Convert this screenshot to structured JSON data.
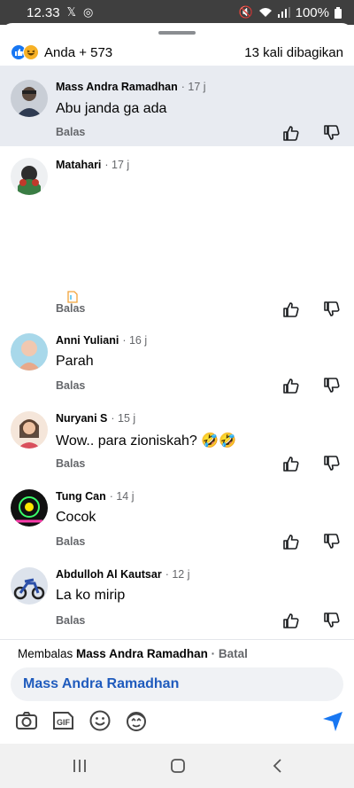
{
  "status_bar": {
    "time": "12.33",
    "battery": "100%"
  },
  "reactions": {
    "label": "Anda + 573",
    "shares": "13 kali dibagikan"
  },
  "comments": [
    {
      "name": "Mass Andra Ramadhan",
      "time": "· 17 j",
      "text": "Abu janda ga ada",
      "reply": "Balas",
      "avatar_color": "#6b7a8f"
    },
    {
      "name": "Matahari",
      "time": "· 17 j",
      "text": "",
      "reply": "Balas",
      "avatar_color": "#7a3b3b"
    },
    {
      "name": "Anni Yuliani",
      "time": "· 16 j",
      "text": "Parah",
      "reply": "Balas",
      "avatar_color": "#e8a98a"
    },
    {
      "name": "Nuryani S",
      "time": "· 15 j",
      "text": "Wow.. para zioniskah? 🤣🤣",
      "reply": "Balas",
      "avatar_color": "#d9a07a"
    },
    {
      "name": "Tung Can",
      "time": "· 14 j",
      "text": "Cocok",
      "reply": "Balas",
      "avatar_color": "#1b1b2e"
    },
    {
      "name": "Abdulloh Al Kautsar",
      "time": "· 12 j",
      "text": "La ko mirip",
      "reply": "Balas",
      "avatar_color": "#4a5f8a"
    }
  ],
  "reply_footer": {
    "prefix": "Membalas",
    "target": "Mass Andra Ramadhan",
    "cancel": "· Batal",
    "input_value": "Mass Andra Ramadhan"
  },
  "colors": {
    "fb_blue": "#1877f2",
    "highlight": "#e8ebf1",
    "secondary_text": "#65676b"
  }
}
